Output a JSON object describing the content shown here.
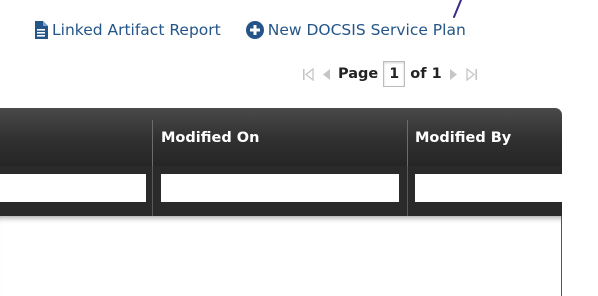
{
  "toolbar": {
    "report_link": "Linked Artifact Report",
    "new_plan_link": "New DOCSIS Service Plan"
  },
  "pager": {
    "page_label": "Page",
    "current_page": "1",
    "of_label": "of 1"
  },
  "grid": {
    "columns": [
      {
        "label": ""
      },
      {
        "label": "Modified On"
      },
      {
        "label": "Modified By"
      }
    ],
    "filters": [
      "",
      "",
      ""
    ]
  },
  "colors": {
    "link": "#245588",
    "header_dark": "#303030",
    "pager_disabled": "#c6c6c6"
  }
}
